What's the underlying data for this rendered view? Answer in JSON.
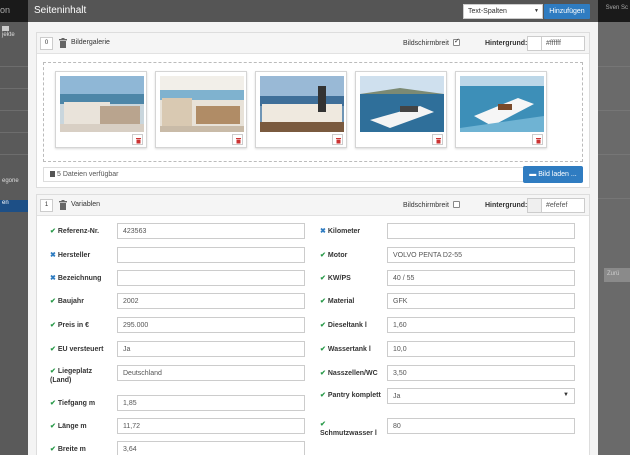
{
  "background": {
    "app_title": "on",
    "user": "Sven Sc",
    "sidebar": {
      "item1": "jekte",
      "item2": "egorie",
      "item3": "en"
    },
    "right_button": "Zurü"
  },
  "modal": {
    "title": "Seiteninhalt",
    "type_select_value": "Text-Spalten",
    "add_button": "Hinzufügen"
  },
  "gallery": {
    "order": "0",
    "title": "Bildergalerie",
    "fullwidth_label": "Bildschirmbreit",
    "fullwidth_checked": true,
    "bg_label": "Hintergrund:",
    "bg_color": "#ffffff",
    "files_text": "5 Dateien verfügbar",
    "load_button": "Bild laden ...",
    "images": [
      {
        "name": "yacht-interior-1"
      },
      {
        "name": "yacht-interior-2"
      },
      {
        "name": "yacht-deck"
      },
      {
        "name": "yacht-at-sea-1"
      },
      {
        "name": "yacht-at-sea-2"
      }
    ]
  },
  "variables": {
    "order": "1",
    "title": "Variablen",
    "fullwidth_label": "Bildschirmbreit",
    "fullwidth_checked": false,
    "bg_label": "Hintergrund:",
    "bg_color": "#efefef",
    "left": [
      {
        "label": "Referenz-Nr.",
        "value": "423563",
        "ok": true
      },
      {
        "label": "Hersteller",
        "value": "",
        "ok": false
      },
      {
        "label": "Bezeichnung",
        "value": "",
        "ok": false
      },
      {
        "label": "Baujahr",
        "value": "2002",
        "ok": true
      },
      {
        "label": "Preis in €",
        "value": "295.000",
        "ok": true
      },
      {
        "label": "EU versteuert",
        "value": "Ja",
        "ok": true
      },
      {
        "label": "Liegeplatz (Land)",
        "value": "Deutschland",
        "ok": true
      },
      {
        "label": "Tiefgang m",
        "value": "1,85",
        "ok": true
      },
      {
        "label": "Länge m",
        "value": "11,72",
        "ok": true
      },
      {
        "label": "Breite m",
        "value": "3,64",
        "ok": true
      }
    ],
    "right": [
      {
        "label": "Kilometer",
        "value": "",
        "ok": false
      },
      {
        "label": "Motor",
        "value": "VOLVO PENTA D2-55",
        "ok": true
      },
      {
        "label": "KW/PS",
        "value": "40 / 55",
        "ok": true
      },
      {
        "label": "Material",
        "value": "GFK",
        "ok": true
      },
      {
        "label": "Dieseltank l",
        "value": "1,60",
        "ok": true
      },
      {
        "label": "Wassertank l",
        "value": "10,0",
        "ok": true
      },
      {
        "label": "Nasszellen/WC",
        "value": "3,50",
        "ok": true
      },
      {
        "label": "Pantry komplett",
        "value": "Ja",
        "ok": true,
        "select": true
      },
      {
        "label": "Schmutzwasser l",
        "value": "80",
        "ok": true
      }
    ]
  },
  "colors": {
    "accent": "#2f7cc1",
    "ok": "#2a9a4a",
    "header": "#555555"
  }
}
